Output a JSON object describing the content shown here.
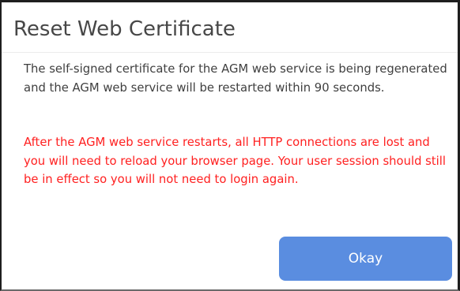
{
  "dialog": {
    "title": "Reset Web Certificate",
    "message": "The self-signed certificate for the AGM web service is being regenerated and the AGM web service will be restarted within 90 seconds.",
    "warning": "After the AGM web service restarts, all HTTP connections are lost and you will need to reload your browser page. Your user session should still be in effect so you will not need to login again.",
    "okay_label": "Okay"
  },
  "colors": {
    "title_text": "#474747",
    "body_text": "#3f3f3f",
    "warning_text": "#ff2020",
    "button_background": "#5a8de0",
    "button_text": "#ffffff"
  }
}
